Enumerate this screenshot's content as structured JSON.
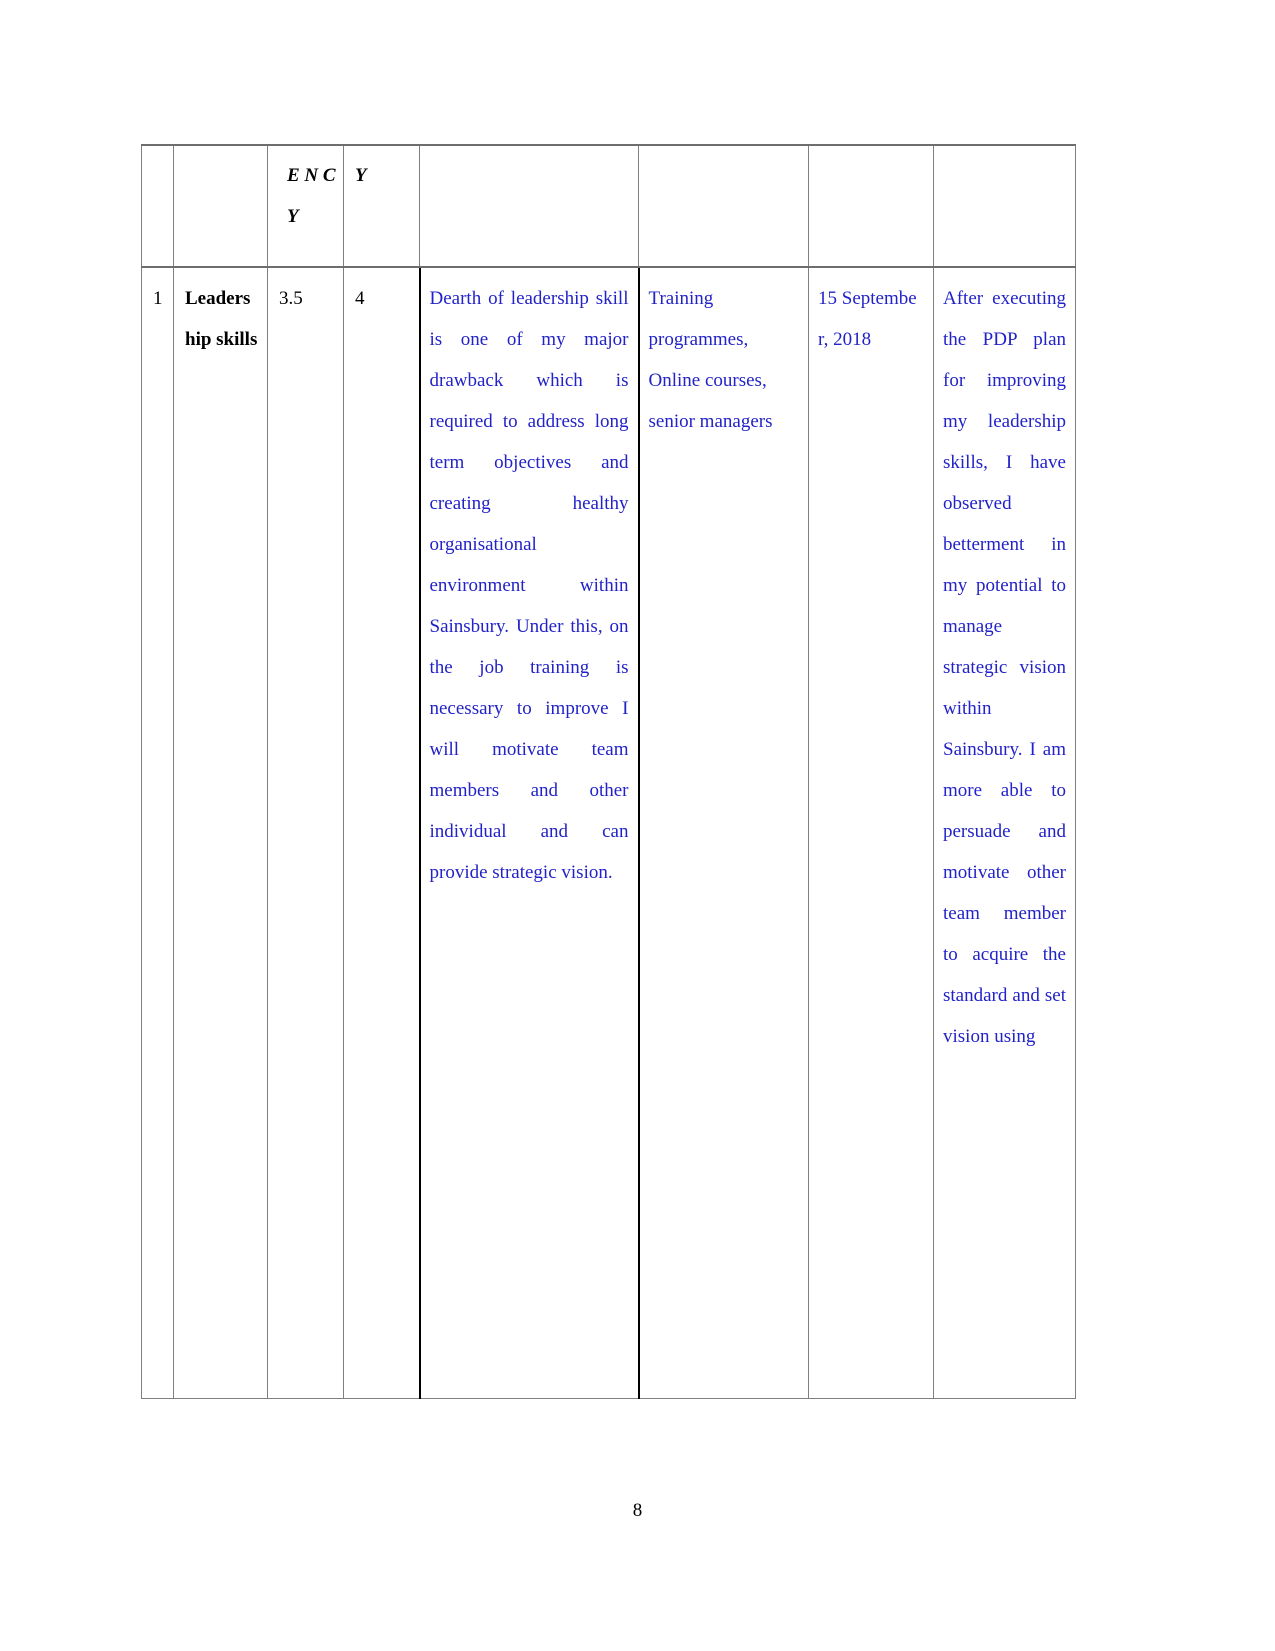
{
  "document": {
    "page_number": "8",
    "text_color_body": "#2222c8",
    "text_color_heading": "#000000",
    "border_color": "#6e6e6e"
  },
  "table": {
    "header_row": {
      "cells": [
        {
          "text": "",
          "name": "header-sl-no"
        },
        {
          "text": "",
          "name": "header-skill"
        },
        {
          "text": "E N CY",
          "name": "header-competency-tail"
        },
        {
          "text": "Y",
          "name": "header-target-tail"
        },
        {
          "text": "",
          "name": "header-development-opportunity"
        },
        {
          "text": "",
          "name": "header-resources"
        },
        {
          "text": "",
          "name": "header-target-date"
        },
        {
          "text": "",
          "name": "header-outcome"
        }
      ]
    },
    "body_rows": [
      {
        "sl_no": "1",
        "skill": "Leadership skills",
        "current_level": "3.5",
        "target_level": "4",
        "development_opportunity": "Dearth of leadership skill is one of my major drawback which is required to address long term objectives and creating healthy organisational environment within Sainsbury. Under this, on the job training is necessary to improve I will motivate team members and other individual and can provide strategic vision.",
        "resources": "Training programmes, Online courses, senior managers",
        "target_date": "15 September, 2018",
        "outcome": "After executing the PDP plan for improving my leadership skills, I have observed betterment in my potential to manage strategic vision within Sainsbury. I am more able to persuade and motivate other team member to acquire the standard and set vision using"
      }
    ]
  }
}
